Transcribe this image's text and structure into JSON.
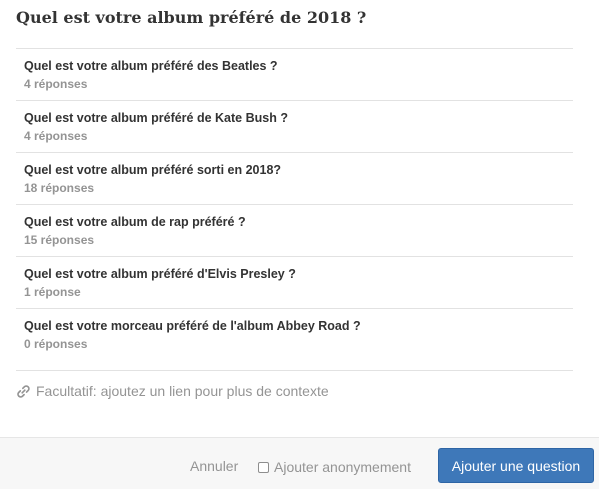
{
  "dialog": {
    "title": "Quel est votre album préféré de 2018 ?"
  },
  "suggestions": [
    {
      "question": "Quel est votre album préféré des Beatles ?",
      "answers": "4 réponses"
    },
    {
      "question": "Quel est votre album préféré de Kate Bush ?",
      "answers": "4 réponses"
    },
    {
      "question": "Quel est votre album préféré sorti en 2018?",
      "answers": "18 réponses"
    },
    {
      "question": "Quel est votre album de rap préféré ?",
      "answers": "15 réponses"
    },
    {
      "question": "Quel est votre album préféré d'Elvis Presley ?",
      "answers": "1 réponse"
    },
    {
      "question": "Quel est votre morceau préféré de l'album Abbey Road ?",
      "answers": "0 réponses"
    }
  ],
  "context_link": {
    "icon": "link-icon",
    "label": "Facultatif: ajoutez un lien pour plus de contexte"
  },
  "footer": {
    "cancel_label": "Annuler",
    "anonymous_label": "Ajouter anonymement",
    "anonymous_checked": false,
    "submit_label": "Ajouter une question"
  },
  "colors": {
    "accent": "#3e78b9",
    "muted_text": "#949494",
    "primary_text": "#333333"
  }
}
